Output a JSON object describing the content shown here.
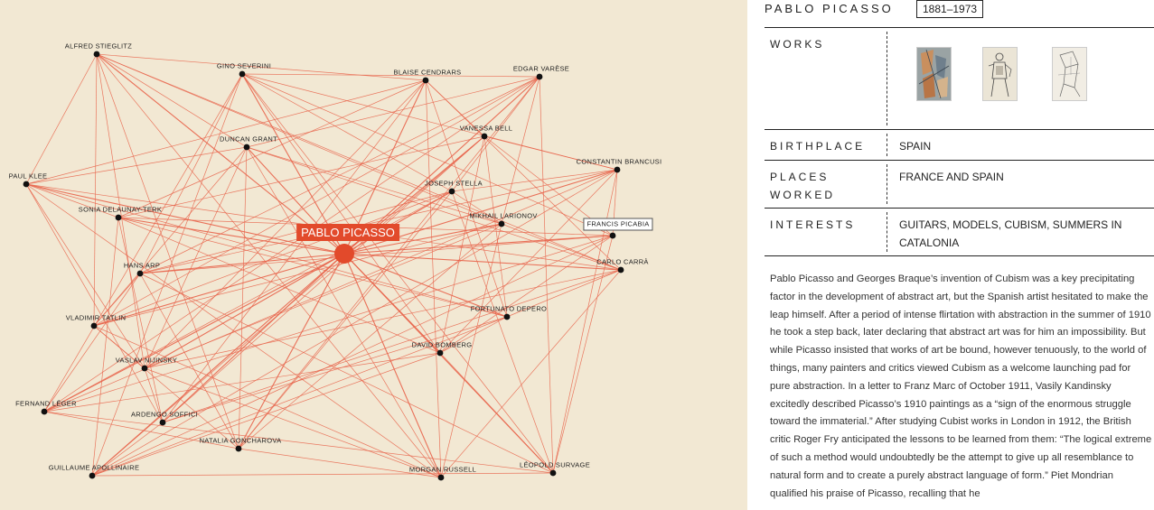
{
  "graph": {
    "focus": {
      "name": "PABLO PICASSO"
    },
    "nodes": [
      {
        "id": "stieglitz",
        "name": "ALFRED STIEGLITZ"
      },
      {
        "id": "severini",
        "name": "GINO SEVERINI"
      },
      {
        "id": "cendrars",
        "name": "BLAISE CENDRARS"
      },
      {
        "id": "varese",
        "name": "EDGAR VARÈSE"
      },
      {
        "id": "bell",
        "name": "VANESSA BELL"
      },
      {
        "id": "grant",
        "name": "DUNCAN GRANT"
      },
      {
        "id": "brancusi",
        "name": "CONSTANTIN BRANCUSI"
      },
      {
        "id": "klee",
        "name": "PAUL KLEE"
      },
      {
        "id": "stella",
        "name": "JOSEPH STELLA"
      },
      {
        "id": "delaunay",
        "name": "SONIA DELAUNAY-TERK"
      },
      {
        "id": "larionov",
        "name": "MIKHAIL LARIONOV"
      },
      {
        "id": "picabia",
        "name": "FRANCIS PICABIA"
      },
      {
        "id": "carra",
        "name": "CARLO CARRÀ"
      },
      {
        "id": "arp",
        "name": "HANS ARP"
      },
      {
        "id": "depero",
        "name": "FORTUNATO DEPERO"
      },
      {
        "id": "tatlin",
        "name": "VLADIMIR TATLIN"
      },
      {
        "id": "bomberg",
        "name": "DAVID BOMBERG"
      },
      {
        "id": "nijinsky",
        "name": "VASLAV NIJINSKY"
      },
      {
        "id": "leger",
        "name": "FERNAND LÉGER"
      },
      {
        "id": "soffici",
        "name": "ARDENGO SOFFICI"
      },
      {
        "id": "goncharova",
        "name": "NATALIA GONCHAROVA"
      },
      {
        "id": "apollinaire",
        "name": "GUILLAUME APOLLINAIRE"
      },
      {
        "id": "russell",
        "name": "MORGAN RUSSELL"
      },
      {
        "id": "survage",
        "name": "LÉOPOLD SURVAGE"
      }
    ]
  },
  "colors": {
    "edge": "#e8634a",
    "focus": "#e24a2b",
    "node": "#111111",
    "background": "#f2e8d3"
  },
  "artist": {
    "name": "PABLO PICASSO",
    "dates": "1881–1973",
    "works_label": "WORKS",
    "works": [
      {
        "name": "artwork-thumbnail-1"
      },
      {
        "name": "artwork-thumbnail-2"
      },
      {
        "name": "artwork-thumbnail-3"
      }
    ],
    "birthplace_label": "BIRTHPLACE",
    "birthplace": "SPAIN",
    "places_label": "PLACES WORKED",
    "places": "FRANCE AND SPAIN",
    "interests_label": "INTERESTS",
    "interests": "GUITARS, MODELS, CUBISM, SUMMERS IN CATALONIA",
    "description": "Pablo Picasso and Georges Braque’s invention of Cubism was a key precipitating factor in the development of abstract art, but the Spanish artist hesitated to make the leap himself. After a period of intense flirtation with abstraction in the summer of 1910 he took a step back, later declaring that abstract art was for him an impossibility. But while Picasso insisted that works of art be bound, however tenuously, to the world of things, many painters and critics viewed Cubism as a welcome launching pad for pure abstraction. In a letter to Franz Marc of October 1911, Vasily Kandinsky excitedly described Picasso’s 1910 paintings as a “sign of the enormous struggle toward the immaterial.” After studying Cubist works in London in 1912, the British critic Roger Fry anticipated the lessons to be learned from them: “The logical extreme of such a method would undoubtedly be the attempt to give up all resemblance to natural form and to create a purely abstract language of form.” Piet Mondrian qualified his praise of Picasso, recalling that he"
  }
}
